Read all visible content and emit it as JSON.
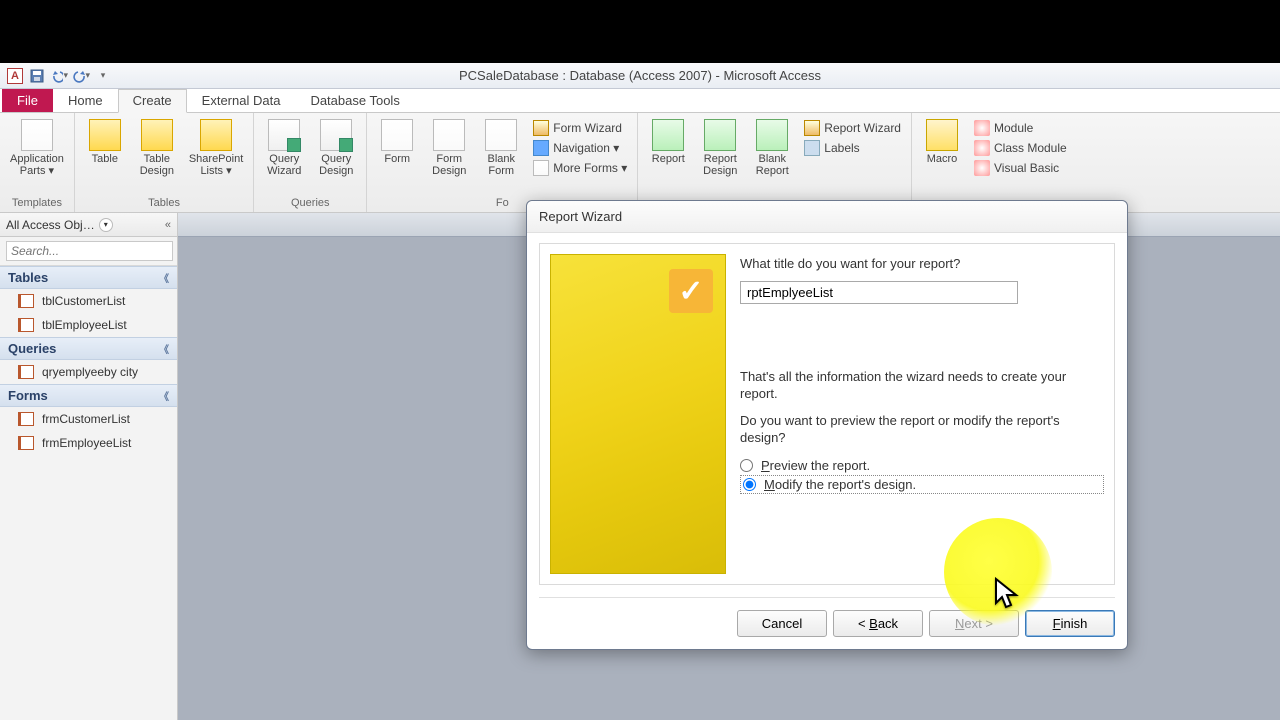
{
  "title_bar": {
    "app_label": "A",
    "title": "PCSaleDatabase : Database (Access 2007)  -  Microsoft Access"
  },
  "ribbon": {
    "tabs": {
      "file": "File",
      "home": "Home",
      "create": "Create",
      "external_data": "External Data",
      "database_tools": "Database Tools"
    },
    "groups": {
      "templates": {
        "label": "Templates",
        "application_parts": "Application\nParts ▾"
      },
      "tables": {
        "label": "Tables",
        "table": "Table",
        "table_design": "Table\nDesign",
        "sharepoint_lists": "SharePoint\nLists ▾"
      },
      "queries": {
        "label": "Queries",
        "query_wizard": "Query\nWizard",
        "query_design": "Query\nDesign"
      },
      "forms": {
        "label": "Fo",
        "form": "Form",
        "form_design": "Form\nDesign",
        "blank_form": "Blank\nForm",
        "form_wizard": "Form Wizard",
        "navigation": "Navigation ▾",
        "more_forms": "More Forms ▾"
      },
      "reports": {
        "report": "Report",
        "report_design": "Report\nDesign",
        "blank_report": "Blank\nReport",
        "report_wizard": "Report Wizard",
        "labels": "Labels"
      },
      "macros": {
        "macro": "Macro",
        "module": "Module",
        "class_module": "Class Module",
        "visual_basic": "Visual Basic"
      }
    }
  },
  "nav_pane": {
    "header": "All Access Obj…",
    "search_placeholder": "Search...",
    "categories": {
      "tables": "Tables",
      "queries": "Queries",
      "forms": "Forms"
    },
    "items": {
      "tblCustomerList": "tblCustomerList",
      "tblEmployeeList": "tblEmployeeList",
      "qryemplyeeby_city": "qryemplyeeby city",
      "frmCustomerList": "frmCustomerList",
      "frmEmployeeList": "frmEmployeeList"
    }
  },
  "dialog": {
    "title": "Report Wizard",
    "question_title": "What title do you want for your report?",
    "title_input_value": "rptEmplyeeList",
    "info_line1": "That's all the information the wizard needs to create your report.",
    "info_line2": "Do you want to preview the report or modify the report's design?",
    "radio_preview": "Preview the report.",
    "radio_modify": "Modify the report's design.",
    "buttons": {
      "cancel": "Cancel",
      "back": "< Back",
      "next": "Next >",
      "finish": "Finish"
    }
  }
}
